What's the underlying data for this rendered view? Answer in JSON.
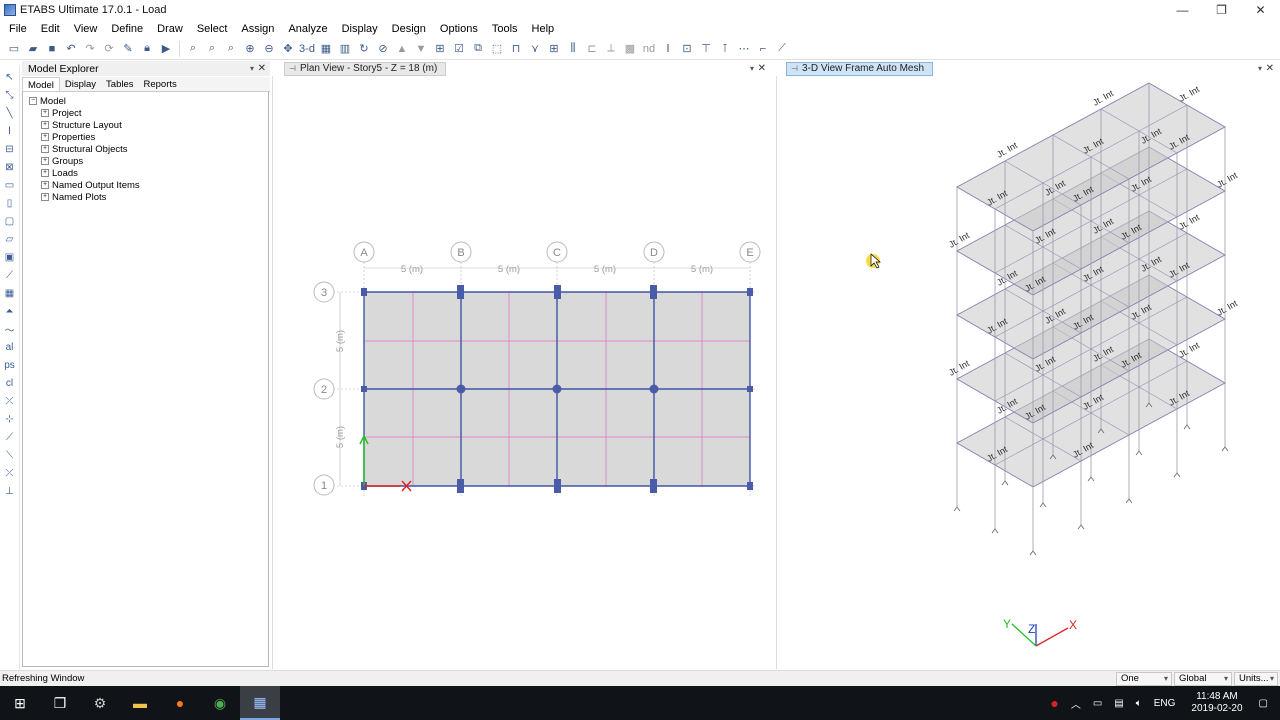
{
  "window": {
    "title": "ETABS Ultimate 17.0.1 - Load",
    "min": "—",
    "max": "❐",
    "close": "✕"
  },
  "menu": [
    "File",
    "Edit",
    "View",
    "Define",
    "Draw",
    "Select",
    "Assign",
    "Analyze",
    "Display",
    "Design",
    "Options",
    "Tools",
    "Help"
  ],
  "toolbar": {
    "view_3d_label": "3-d",
    "nd_label": "nd"
  },
  "explorer": {
    "title": "Model Explorer",
    "tabs": [
      "Model",
      "Display",
      "Tables",
      "Reports"
    ],
    "active_tab": "Model",
    "root": "Model",
    "items": [
      "Project",
      "Structure Layout",
      "Properties",
      "Structural Objects",
      "Groups",
      "Loads",
      "Named Output Items",
      "Named Plots"
    ]
  },
  "plan_view": {
    "title": "Plan View - Story5 - Z = 18 (m)",
    "grid_x": [
      "A",
      "B",
      "C",
      "D",
      "E"
    ],
    "grid_y": [
      "3",
      "2",
      "1"
    ],
    "spacing_x": [
      "5 (m)",
      "5 (m)",
      "5 (m)",
      "5 (m)"
    ],
    "spacing_y": [
      "5 (m)",
      "5 (m)"
    ],
    "colors": {
      "slab": "#d9d9d9",
      "beam": "#3d55a8",
      "mesh": "#e070c8",
      "column": "#4a5ca8",
      "axis_x": "#e02020",
      "axis_y": "#20c020"
    }
  },
  "view3d": {
    "title": "3-D View  Frame Auto Mesh",
    "joint_label": "Jt. Int",
    "axis_labels": {
      "x": "X",
      "y": "Y",
      "z": "Z"
    }
  },
  "status": {
    "message": "Refreshing Window",
    "story_select": "One Story",
    "coord_select": "Global",
    "units_button": "Units..."
  },
  "taskbar": {
    "lang": "ENG",
    "time": "11:48 AM",
    "date": "2019-02-20"
  }
}
